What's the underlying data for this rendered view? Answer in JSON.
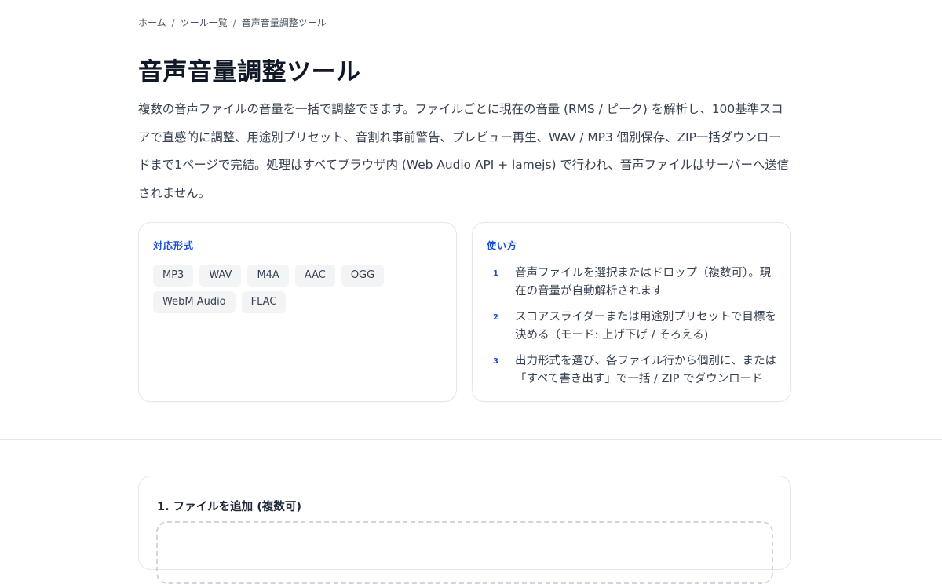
{
  "breadcrumb": {
    "home": "ホーム",
    "tools": "ツール一覧",
    "current": "音声音量調整ツール",
    "separator": "/"
  },
  "page_title": "音声音量調整ツール",
  "description": "複数の音声ファイルの音量を一括で調整できます。ファイルごとに現在の音量 (RMS / ピーク) を解析し、100基準スコアで直感的に調整、用途別プリセット、音割れ事前警告、プレビュー再生、WAV / MP3 個別保存、ZIP一括ダウンロードまで1ページで完結。処理はすべてブラウザ内 (Web Audio API + lamejs) で行われ、音声ファイルはサーバーへ送信されません。",
  "formats_card": {
    "title": "対応形式",
    "tags": [
      "MP3",
      "WAV",
      "M4A",
      "AAC",
      "OGG",
      "WebM Audio",
      "FLAC"
    ]
  },
  "howto_card": {
    "title": "使い方",
    "steps": [
      {
        "num": "1",
        "text": "音声ファイルを選択またはドロップ（複数可）。現在の音量が自動解析されます"
      },
      {
        "num": "2",
        "text": "スコアスライダーまたは用途別プリセットで目標を決める（モード: 上げ下げ / そろえる)"
      },
      {
        "num": "3",
        "text": "出力形式を選び、各ファイル行から個別に、または「すべて書き出す」で一括 / ZIP でダウンロード"
      }
    ]
  },
  "upload": {
    "title": "1. ファイルを追加 (複数可)"
  },
  "colors": {
    "accent": "#1d4ed8",
    "text": "#374151",
    "border": "#e5e7eb",
    "tag_bg": "#f3f4f6"
  }
}
